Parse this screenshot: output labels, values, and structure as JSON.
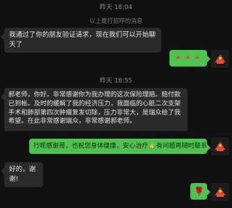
{
  "chat": {
    "time1": "昨天 18:04",
    "notice": "以上是打招呼的消息",
    "msg1": "我通过了你的朋友验证请求，现在我们可以开始聊天了",
    "emoji1": [
      "🔺",
      "🔺",
      "🔺"
    ],
    "time2": "昨天 18:55",
    "msg2": "郝老师，你好。非常感谢你为我办理的这次保险理赔。赔付款已到帐。及时的缓解了我的经济压力，我面临的心脏二次支架手术和肺部第四次肿瘤复发切除，压力非常大，是瑞众给了我希望。在此非常感谢瑞众，非常感谢郝老师。",
    "msg3_part1": "行呢感谢哥，也祝您身体健康，安心治疗",
    "msg3_emoji": "🙏",
    "msg3_part2": "有问题再随时联系",
    "msg4": "好的，谢谢!",
    "sticker": "🌹"
  },
  "colors": {
    "outgoing": "#4fc24f",
    "incoming": "#2b2b2b",
    "background": "#111111"
  }
}
